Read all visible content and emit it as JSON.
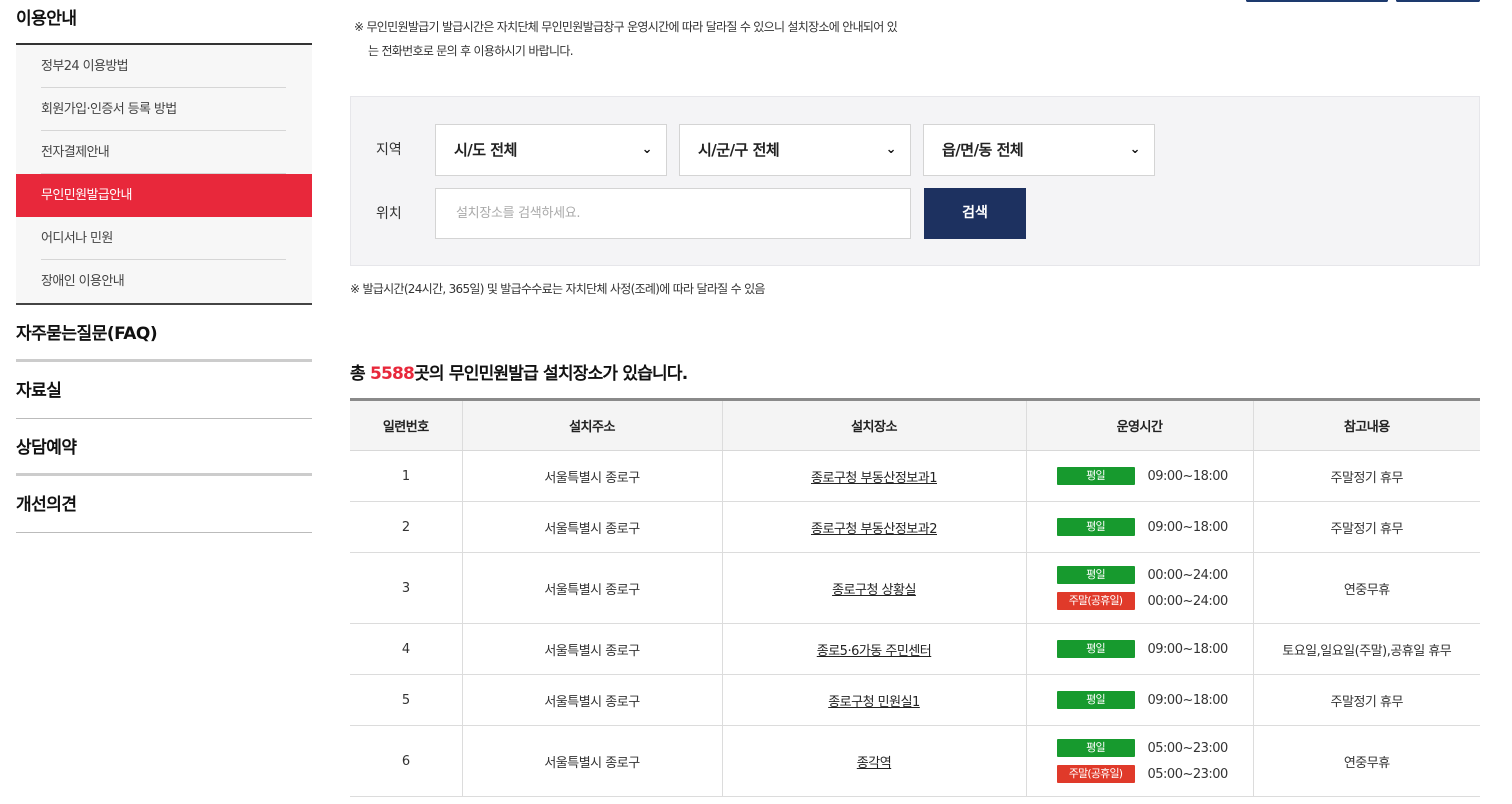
{
  "sidebar": {
    "section_title": "이용안내",
    "sub_items": [
      {
        "label": "정부24 이용방법",
        "active": false
      },
      {
        "label": "회원가입·인증서 등록 방법",
        "active": false
      },
      {
        "label": "전자결제안내",
        "active": false
      },
      {
        "label": "무인민원발급안내",
        "active": true
      },
      {
        "label": "어디서나 민원",
        "active": false
      },
      {
        "label": "장애인 이용안내",
        "active": false
      }
    ],
    "menu_items": [
      {
        "label": "자주묻는질문(FAQ)"
      },
      {
        "label": "자료실"
      },
      {
        "label": "상담예약"
      },
      {
        "label": "개선의견"
      }
    ]
  },
  "notice": {
    "line1": "※ 무인민원발급기 발급시간은 자치단체 무인민원발급창구 운영시간에 따라 달라질 수 있으니 설치장소에 안내되어 있",
    "line2": "는 전화번호로 문의 후 이용하시기 바랍니다."
  },
  "search": {
    "region_label": "지역",
    "location_label": "위치",
    "sido_selected": "시/도 전체",
    "sigungu_selected": "시/군/구 전체",
    "eupmyeondong_selected": "읍/면/동 전체",
    "location_placeholder": "설치장소를 검색하세요.",
    "search_button": "검색"
  },
  "fee_note": "※ 발급시간(24시간, 365일) 및 발급수수료는 자치단체 사정(조례)에 따라 달라질 수 있음",
  "total": {
    "prefix": "총 ",
    "count": "5588",
    "suffix": "곳의 무인민원발급 설치장소가 있습니다."
  },
  "table": {
    "headers": [
      "일련번호",
      "설치주소",
      "설치장소",
      "운영시간",
      "참고내용"
    ],
    "badge_weekday": "평일",
    "badge_holiday": "주말(공휴일)",
    "rows": [
      {
        "no": "1",
        "address": "서울특별시 종로구",
        "place": "종로구청 부동산정보과1",
        "weekday": "09:00~18:00",
        "holiday": null,
        "note": "주말정기 휴무"
      },
      {
        "no": "2",
        "address": "서울특별시 종로구",
        "place": "종로구청 부동산정보과2",
        "weekday": "09:00~18:00",
        "holiday": null,
        "note": "주말정기 휴무"
      },
      {
        "no": "3",
        "address": "서울특별시 종로구",
        "place": "종로구청 상황실",
        "weekday": "00:00~24:00",
        "holiday": "00:00~24:00",
        "note": "연중무휴"
      },
      {
        "no": "4",
        "address": "서울특별시 종로구",
        "place": "종로5·6가동 주민센터",
        "weekday": "09:00~18:00",
        "holiday": null,
        "note": "토요일,일요일(주말),공휴일 휴무"
      },
      {
        "no": "5",
        "address": "서울특별시 종로구",
        "place": "종로구청 민원실1",
        "weekday": "09:00~18:00",
        "holiday": null,
        "note": "주말정기 휴무"
      },
      {
        "no": "6",
        "address": "서울특별시 종로구",
        "place": "종각역",
        "weekday": "05:00~23:00",
        "holiday": "05:00~23:00",
        "note": "연중무휴"
      }
    ]
  }
}
